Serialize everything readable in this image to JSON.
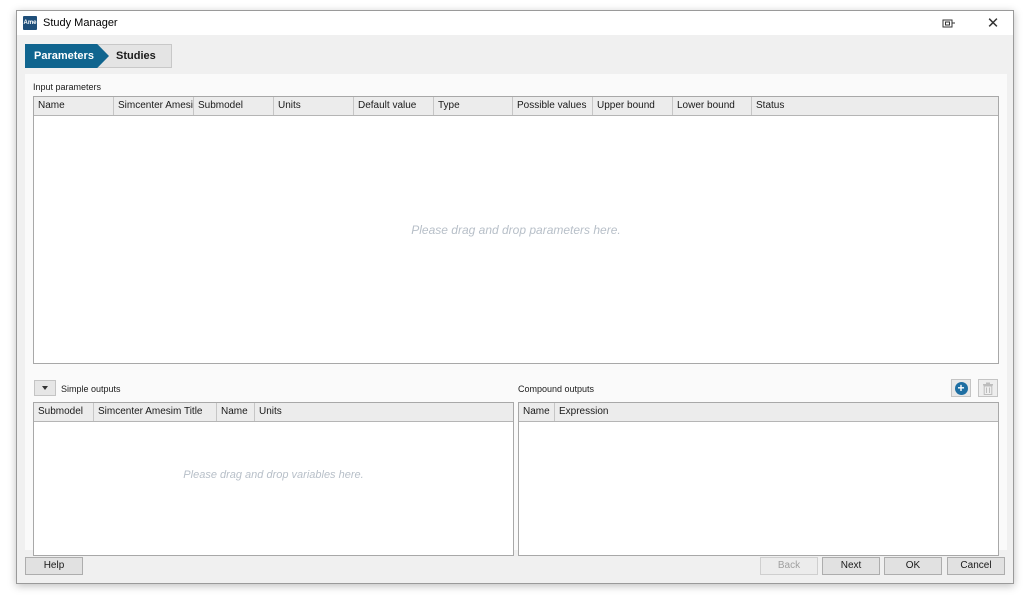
{
  "window": {
    "title": "Study Manager",
    "app_icon_text": "Ame"
  },
  "steps": {
    "active": "Parameters",
    "inactive": "Studies"
  },
  "input_parameters": {
    "label": "Input parameters",
    "columns": [
      "Name",
      "Simcenter Amesim",
      "Submodel",
      "Units",
      "Default value",
      "Type",
      "Possible values",
      "Upper bound",
      "Lower bound",
      "Status"
    ],
    "placeholder": "Please drag and drop parameters here."
  },
  "simple_outputs": {
    "label": "Simple outputs",
    "columns": [
      "Submodel",
      "Simcenter Amesim Title",
      "Name",
      "Units"
    ],
    "placeholder": "Please drag and drop variables here."
  },
  "compound_outputs": {
    "label": "Compound outputs",
    "columns": [
      "Name",
      "Expression"
    ]
  },
  "footer": {
    "help": "Help",
    "back": "Back",
    "next": "Next",
    "ok": "OK",
    "cancel": "Cancel"
  },
  "icons": {
    "app": "amesim-app-icon",
    "restore": "window-restore-icon",
    "close": "close-icon",
    "collapse": "chevron-down-icon",
    "add": "add-icon",
    "delete": "trash-icon"
  },
  "colors": {
    "accent": "#10658f",
    "add_icon": "#1f6fa3"
  }
}
